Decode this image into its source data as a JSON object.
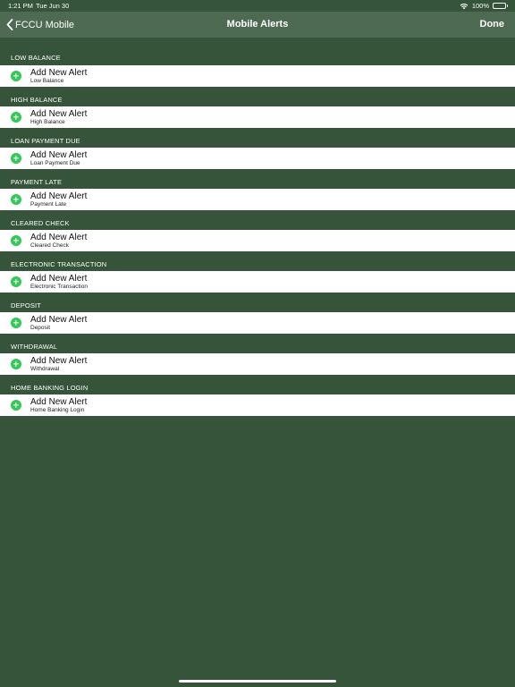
{
  "status_bar": {
    "time": "1:21 PM",
    "date": "Tue Jun 30",
    "battery": "100%",
    "icons": [
      "wifi-icon",
      "battery-icon"
    ]
  },
  "nav": {
    "back_label": "FCCU Mobile",
    "back_icon": "chevron-left-icon",
    "title": "Mobile Alerts",
    "done_label": "Done"
  },
  "colors": {
    "background": "#35543a",
    "nav_background": "#4e6a52",
    "row_background": "#ffffff",
    "add_icon": "#34c759"
  },
  "add_icon": "plus-circle-icon",
  "sections": [
    {
      "header": "LOW BALANCE",
      "row_title": "Add New Alert",
      "row_subtitle": "Low Balance"
    },
    {
      "header": "HIGH BALANCE",
      "row_title": "Add New Alert",
      "row_subtitle": "High Balance"
    },
    {
      "header": "LOAN PAYMENT DUE",
      "row_title": "Add New Alert",
      "row_subtitle": "Loan Payment Due"
    },
    {
      "header": "PAYMENT LATE",
      "row_title": "Add New Alert",
      "row_subtitle": "Payment Late"
    },
    {
      "header": "CLEARED CHECK",
      "row_title": "Add New Alert",
      "row_subtitle": "Cleared Check"
    },
    {
      "header": "ELECTRONIC TRANSACTION",
      "row_title": "Add New Alert",
      "row_subtitle": "Electronic Transaction"
    },
    {
      "header": "DEPOSIT",
      "row_title": "Add New Alert",
      "row_subtitle": "Deposit"
    },
    {
      "header": "WITHDRAWAL",
      "row_title": "Add New Alert",
      "row_subtitle": "Withdrawal"
    },
    {
      "header": "HOME BANKING LOGIN",
      "row_title": "Add New Alert",
      "row_subtitle": "Home Banking Login"
    }
  ]
}
